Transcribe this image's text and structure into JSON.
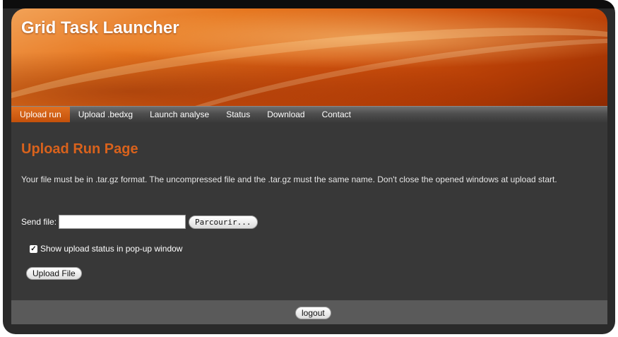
{
  "header": {
    "title": "Grid Task Launcher"
  },
  "nav": {
    "items": [
      {
        "label": "Upload run",
        "active": true
      },
      {
        "label": "Upload .bedxg",
        "active": false
      },
      {
        "label": "Launch analyse",
        "active": false
      },
      {
        "label": "Status",
        "active": false
      },
      {
        "label": "Download",
        "active": false
      },
      {
        "label": "Contact",
        "active": false
      }
    ]
  },
  "main": {
    "page_title": "Upload Run Page",
    "intro": "Your file must be in .tar.gz format. The uncompressed file and the .tar.gz must the same name. Don't close the opened windows at upload start.",
    "send_file": {
      "label": "Send file:",
      "value": "",
      "browse_label": "Parcourir..."
    },
    "popup_status": {
      "label": "Show upload status in pop-up window",
      "checked": true
    },
    "upload_button": "Upload File"
  },
  "footer": {
    "logout_label": "logout"
  },
  "colors": {
    "accent": "#d9621c",
    "active_tab": "#c4510b",
    "content_bg": "#383838",
    "footer_bg": "#5a5a5a"
  }
}
